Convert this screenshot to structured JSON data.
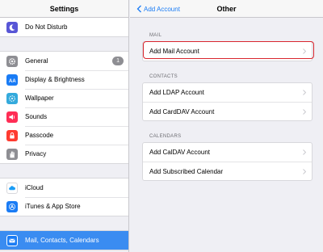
{
  "sidebar": {
    "title": "Settings",
    "items": [
      {
        "label": "Do Not Disturb",
        "icon": "moon-icon",
        "color": "#5856d6"
      },
      {
        "label": "General",
        "icon": "gear-icon",
        "color": "#8e8e93",
        "badge": "1"
      },
      {
        "label": "Display & Brightness",
        "icon": "text-size-icon",
        "color": "#1a7cf5"
      },
      {
        "label": "Wallpaper",
        "icon": "flower-icon",
        "color": "#34aadc"
      },
      {
        "label": "Sounds",
        "icon": "speaker-icon",
        "color": "#ff2d55"
      },
      {
        "label": "Passcode",
        "icon": "lock-icon",
        "color": "#ff3b30"
      },
      {
        "label": "Privacy",
        "icon": "hand-icon",
        "color": "#8e8e93"
      },
      {
        "label": "iCloud",
        "icon": "cloud-icon",
        "color": "#ffffff"
      },
      {
        "label": "iTunes & App Store",
        "icon": "app-store-icon",
        "color": "#1a7cf5"
      },
      {
        "label": "Mail, Contacts, Calendars",
        "icon": "mail-icon",
        "color": "#1a7cf5"
      }
    ]
  },
  "nav": {
    "back_label": "Add Account",
    "title": "Other"
  },
  "sections": [
    {
      "label": "MAIL",
      "rows": [
        "Add Mail Account"
      ]
    },
    {
      "label": "CONTACTS",
      "rows": [
        "Add LDAP Account",
        "Add CardDAV Account"
      ]
    },
    {
      "label": "CALENDARS",
      "rows": [
        "Add CalDAV Account",
        "Add Subscribed Calendar"
      ]
    }
  ],
  "colors": {
    "accent": "#1a7cf5",
    "selected": "#3a8cf1",
    "highlight": "#d9262e"
  }
}
